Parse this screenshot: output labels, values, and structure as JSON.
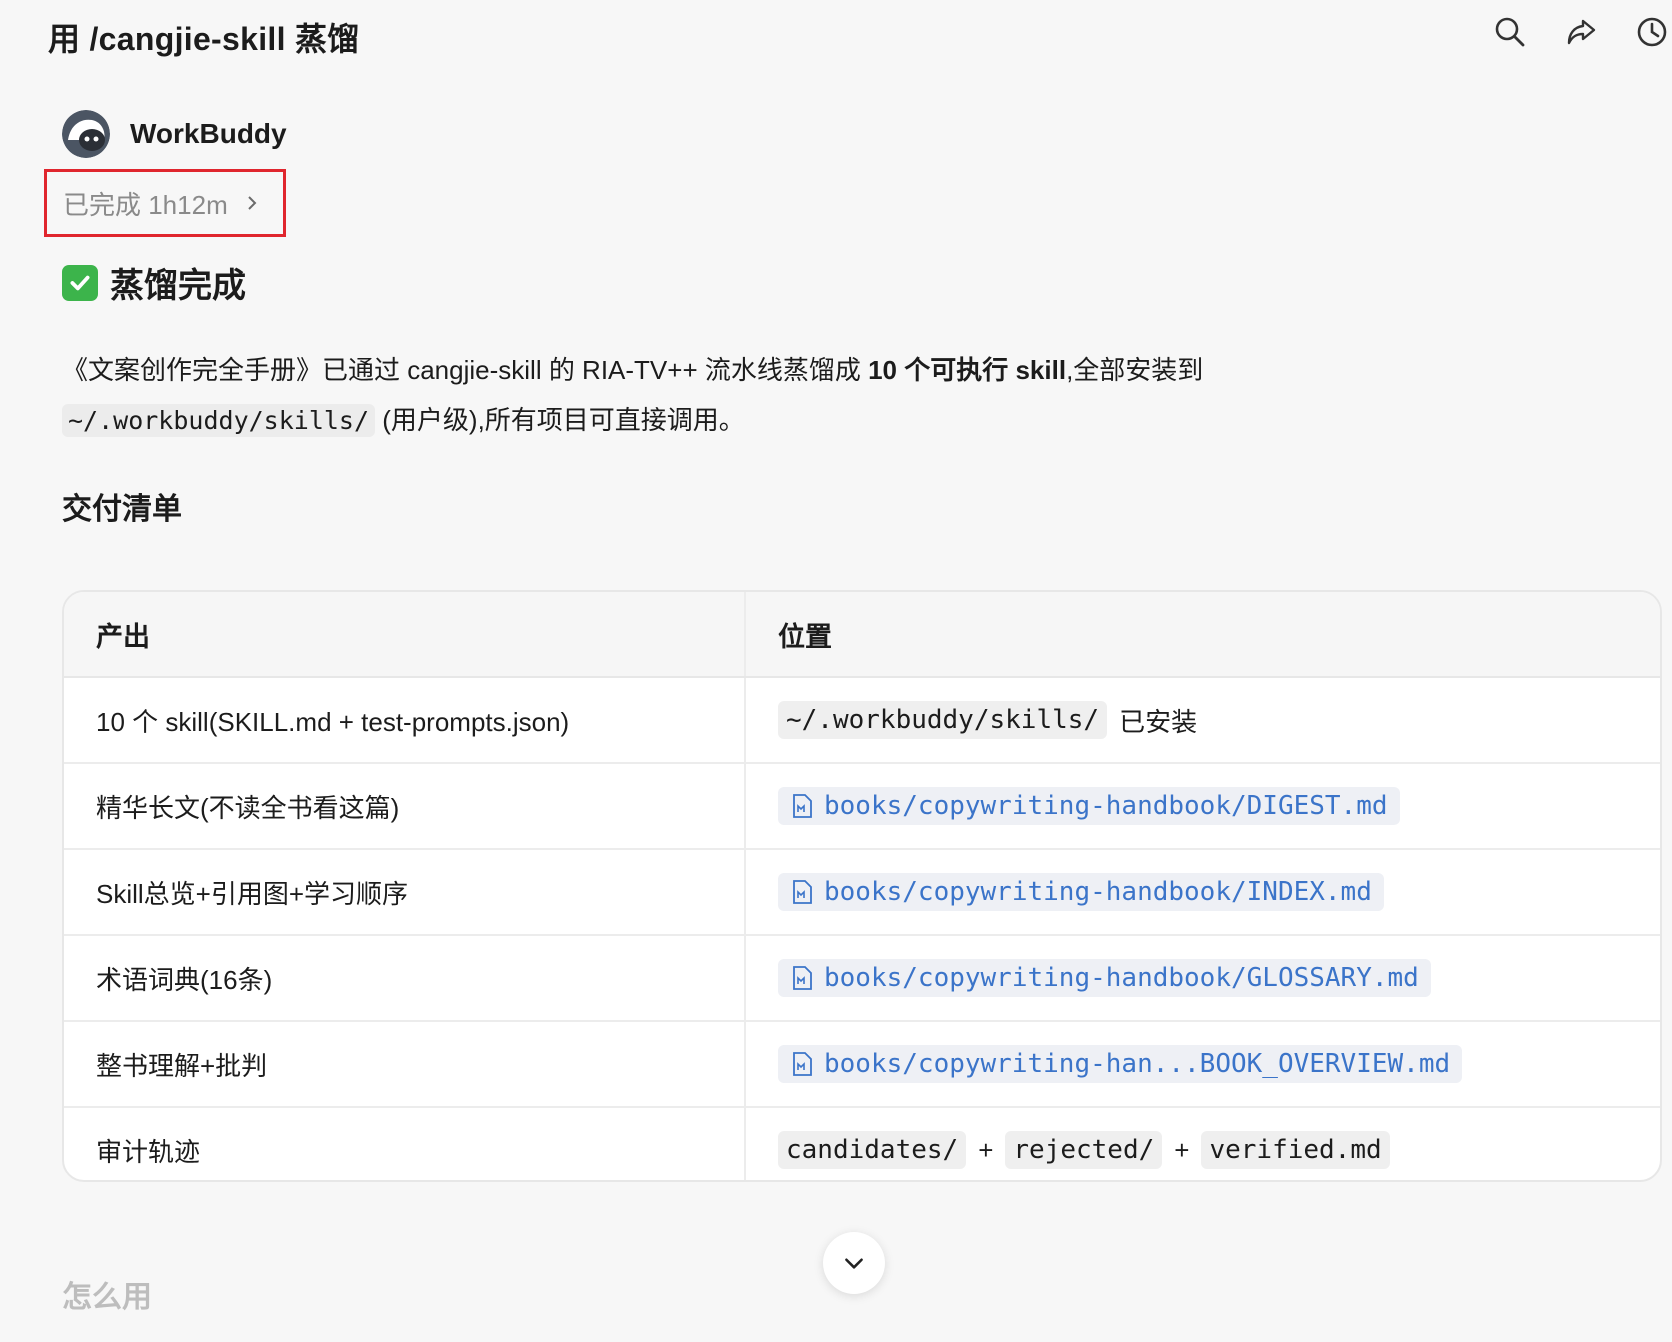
{
  "header": {
    "title": "用 /cangjie-skill 蒸馏",
    "icons": [
      "search-icon",
      "share-icon",
      "history-icon"
    ]
  },
  "agent": {
    "name": "WorkBuddy",
    "status": "已完成 1h12m"
  },
  "message": {
    "heading": "蒸馏完成",
    "para_part1": "《文案创作完全手册》已通过 cangjie-skill 的 RIA-TV++ 流水线蒸馏成 ",
    "para_bold": "10 个可执行 skill",
    "para_part2": ",全部安装到",
    "para_code": "~/.workbuddy/skills/",
    "para_part3": " (用户级),所有项目可直接调用。",
    "section_title": "交付清单",
    "next_section_title": "怎么用"
  },
  "table": {
    "headers": [
      "产出",
      "位置"
    ],
    "rows": [
      {
        "output": "10 个 skill(SKILL.md + test-prompts.json)",
        "code": "~/.workbuddy/skills/",
        "suffix": "已安装"
      },
      {
        "output": "精华长文(不读全书看这篇)",
        "file": "books/copywriting-handbook/DIGEST.md"
      },
      {
        "output": "Skill总览+引用图+学习顺序",
        "file": "books/copywriting-handbook/INDEX.md"
      },
      {
        "output": "术语词典(16条)",
        "file": "books/copywriting-handbook/GLOSSARY.md"
      },
      {
        "output": "整书理解+批判",
        "file": "books/copywriting-han...BOOK_OVERVIEW.md"
      },
      {
        "output": "审计轨迹",
        "codes": [
          "candidates/",
          "rejected/",
          "verified.md"
        ],
        "joiner": "+"
      }
    ]
  },
  "colors": {
    "highlight_border": "#e0262e",
    "link": "#3b74c9",
    "check_green": "#3cb44b"
  }
}
